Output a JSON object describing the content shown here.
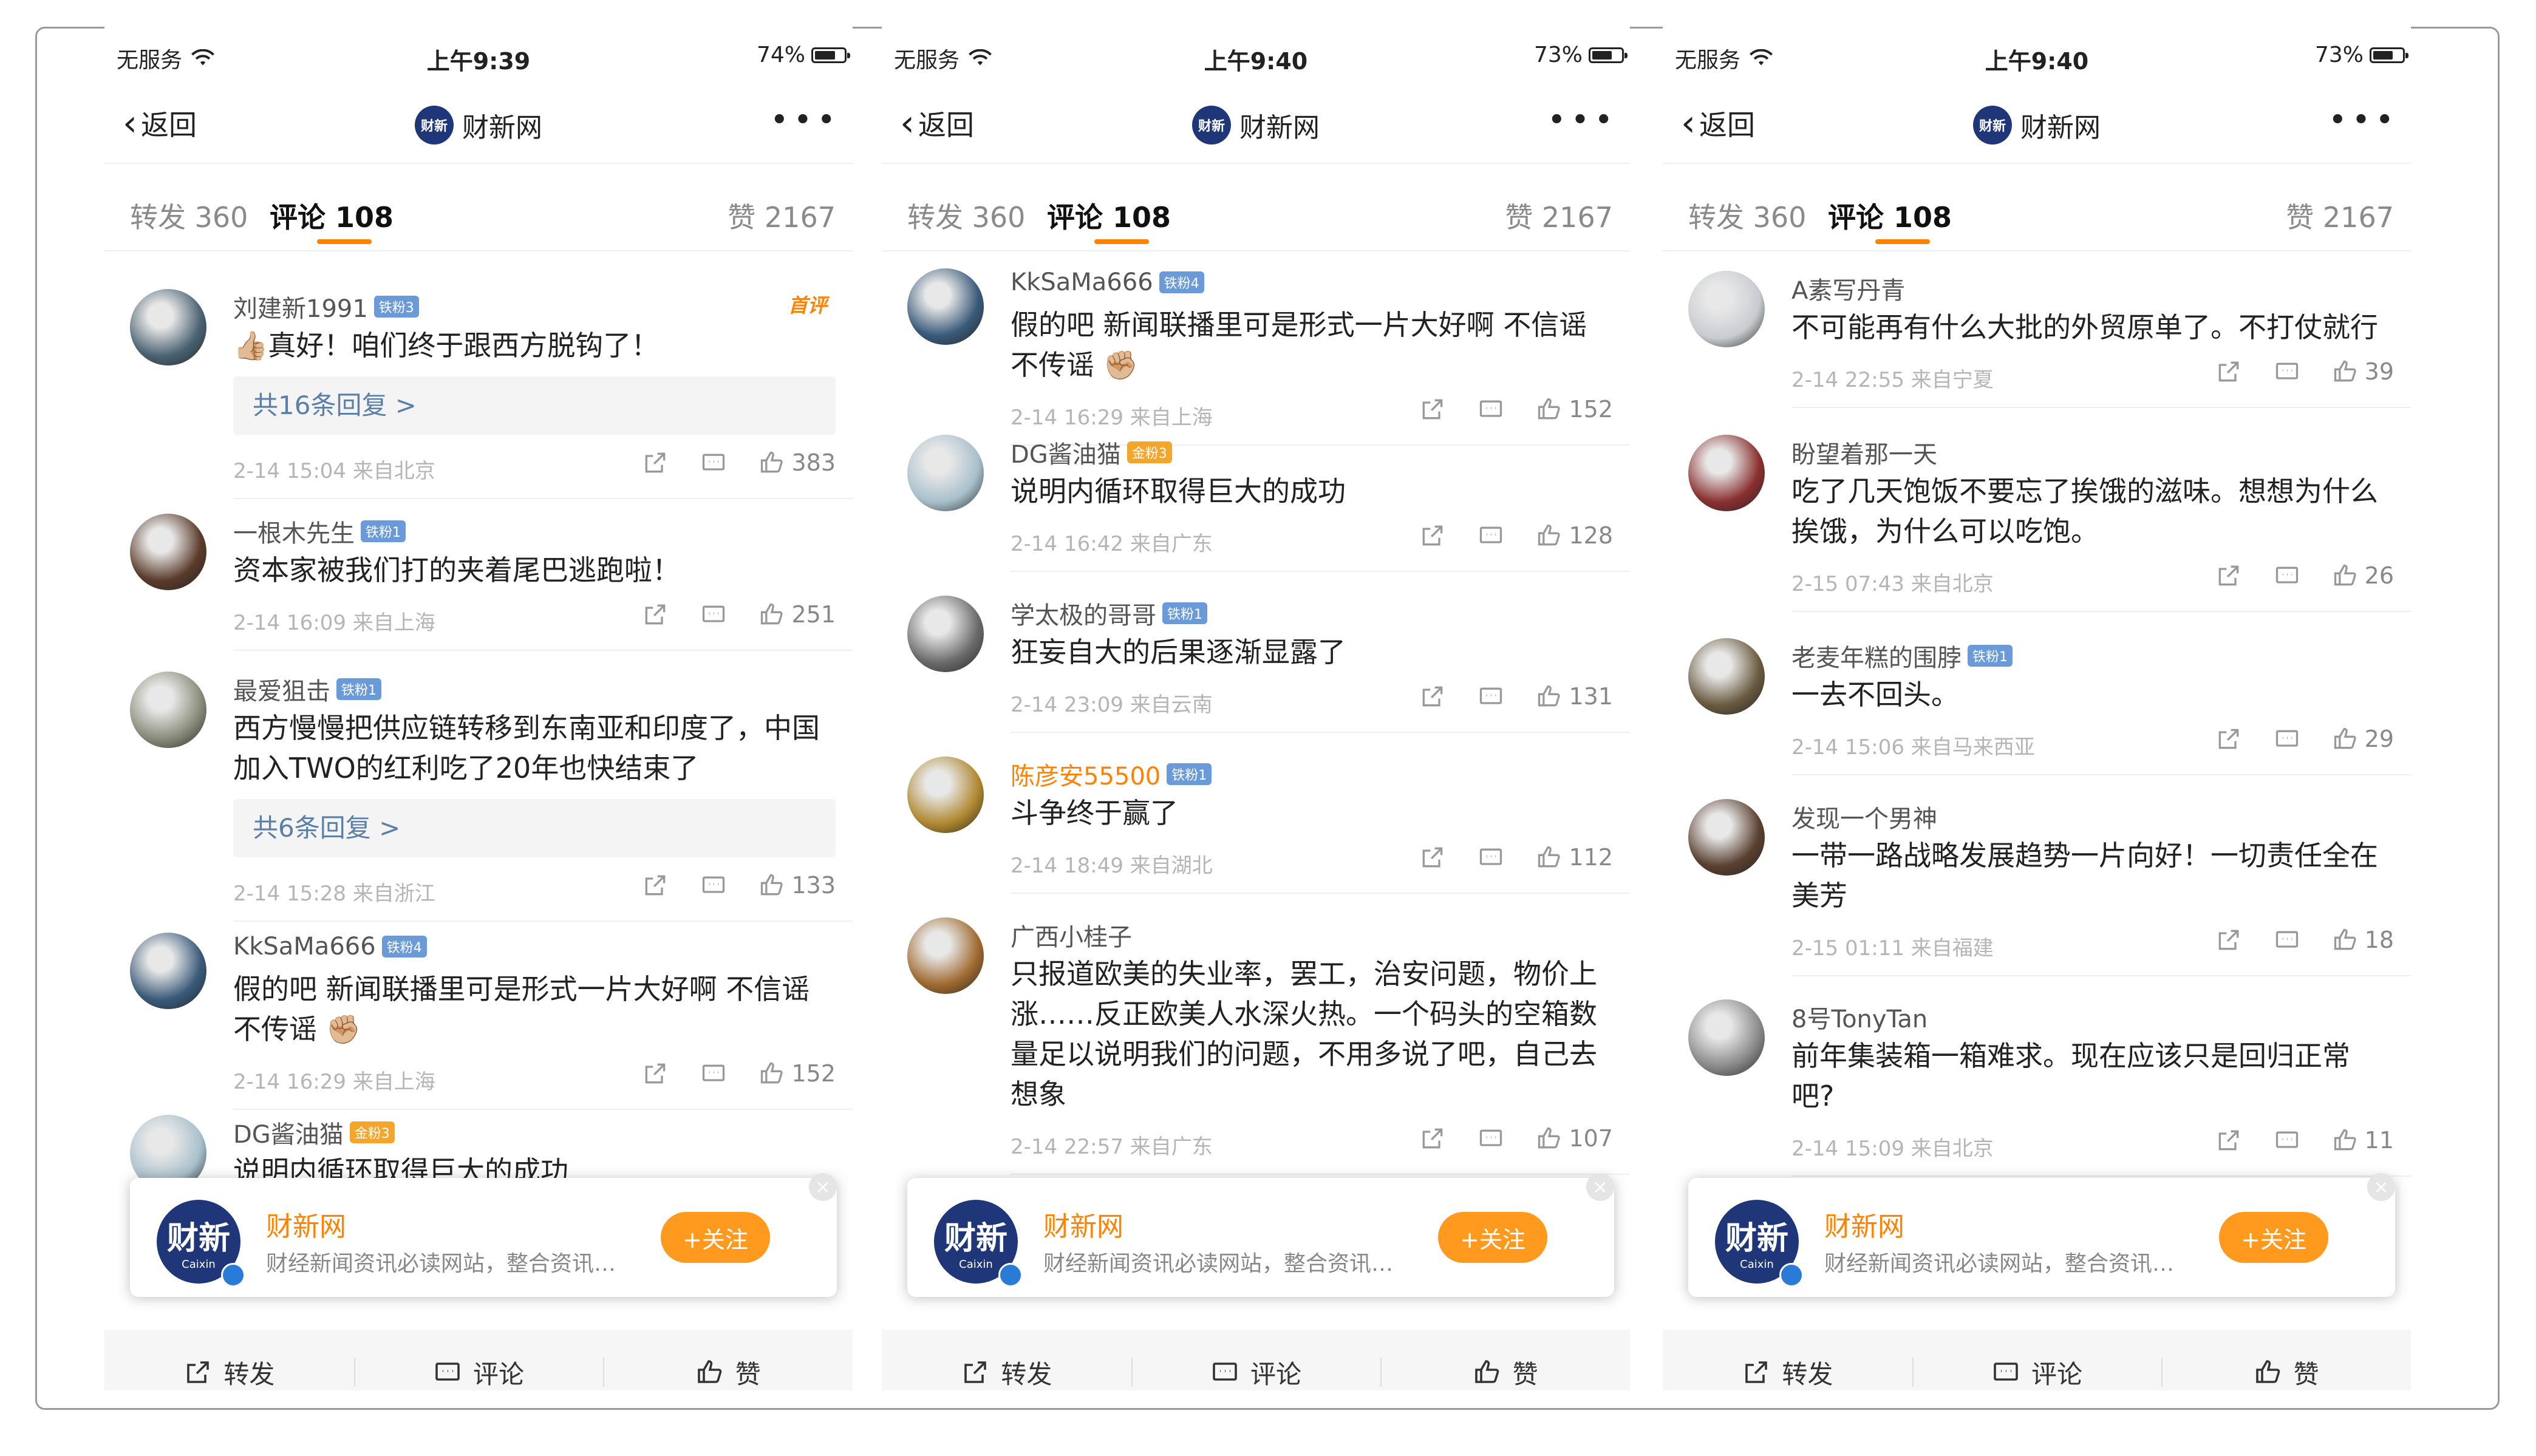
{
  "status_bars": [
    {
      "carrier": "无服务",
      "time": "上午9:39",
      "battery": "74%",
      "battery_level": 74
    },
    {
      "carrier": "无服务",
      "time": "上午9:40",
      "battery": "73%",
      "battery_level": 73
    },
    {
      "carrier": "无服务",
      "time": "上午9:40",
      "battery": "73%",
      "battery_level": 73
    }
  ],
  "nav": {
    "back": "返回",
    "title": "财新网",
    "logo_text": "财新"
  },
  "tabs": {
    "repost": "转发 360",
    "comments": "评论 108",
    "likes": "赞 2167"
  },
  "follow_card": {
    "logo": "财新",
    "logo_sub": "Caixin",
    "name": "财新网",
    "desc": "财经新闻资讯必读网站，整合资讯…",
    "button": "+关注",
    "close": "×"
  },
  "toolbar": {
    "repost": "转发",
    "comment": "评论",
    "like": "赞"
  },
  "phones": [
    {
      "comments": [
        {
          "name": "刘建新1991",
          "badge": "铁粉3",
          "label": "首评",
          "text": "👍🏼真好！咱们终于跟西方脱钩了！",
          "reply": "共16条回复 >",
          "meta": "2-14 15:04  来自北京",
          "likes": "383",
          "av": "#4a6272"
        },
        {
          "name": "一根木先生",
          "badge": "铁粉1",
          "text": "资本家被我们打的夹着尾巴逃跑啦！",
          "meta": "2-14 16:09  来自上海",
          "likes": "251",
          "av": "#5a3a2a"
        },
        {
          "name": "最爱狙击",
          "badge": "铁粉1",
          "text": "西方慢慢把供应链转移到东南亚和印度了，中国加入TWO的红利吃了20年也快结束了",
          "reply": "共6条回复 >",
          "meta": "2-14 15:28  来自浙江",
          "likes": "133",
          "av": "#8a8c7a"
        },
        {
          "name": "KkSaMa666",
          "badge": "铁粉4",
          "text": "假的吧 新闻联播里可是形式一片大好啊 不信谣不传谣 ✊🏼",
          "meta": "2-14 16:29  来自上海",
          "likes": "152",
          "av": "#3a5a7a"
        },
        {
          "name": "DG酱油猫",
          "badge": "金粉3",
          "gold": true,
          "text": "说明内循环取得巨大的成功",
          "meta": "",
          "likes": "",
          "av": "#a8c0cc"
        }
      ]
    },
    {
      "comments": [
        {
          "name": "KkSaMa666",
          "badge": "铁粉4",
          "text": "假的吧 新闻联播里可是形式一片大好啊 不信谣不传谣 ✊🏼",
          "meta": "2-14 16:29  来自上海",
          "likes": "152",
          "av": "#3a5a7a"
        },
        {
          "name": "DG酱油猫",
          "badge": "金粉3",
          "gold": true,
          "text": "说明内循环取得巨大的成功",
          "meta": "2-14 16:42  来自广东",
          "likes": "128",
          "av": "#a8c0cc"
        },
        {
          "name": "学太极的哥哥",
          "badge": "铁粉1",
          "text": "狂妄自大的后果逐渐显露了",
          "meta": "2-14 23:09  来自云南",
          "likes": "131",
          "av": "#6a6a6a"
        },
        {
          "name": "陈彦安55500",
          "badge": "铁粉1",
          "vip": true,
          "text": "斗争终于赢了",
          "meta": "2-14 18:49  来自湖北",
          "likes": "112",
          "av": "#b08830"
        },
        {
          "name": "广西小桂子",
          "badge": "",
          "text": "只报道欧美的失业率，罢工，治安问题，物价上涨……反正欧美人水深火热。一个码头的空箱数量足以说明我们的问题，不用多说了吧，自己去想象",
          "meta": "2-14 22:57  来自广东",
          "likes": "107",
          "av": "#a06a30"
        }
      ]
    },
    {
      "comments": [
        {
          "name": "A素写丹青",
          "badge": "",
          "text": "不可能再有什么大批的外贸原单了。不打仗就行",
          "meta": "2-14 22:55  来自宁夏",
          "likes": "39",
          "av": "#c8ccd0"
        },
        {
          "name": "盼望着那一天",
          "badge": "",
          "text": "吃了几天饱饭不要忘了挨饿的滋味。想想为什么挨饿，为什么可以吃饱。",
          "meta": "2-15 07:43  来自北京",
          "likes": "26",
          "av": "#8a3030"
        },
        {
          "name": "老麦年糕的围脖",
          "badge": "铁粉1",
          "text": "一去不回头。",
          "meta": "2-14 15:06  来自马来西亚",
          "likes": "29",
          "av": "#6a5a40"
        },
        {
          "name": "发现一个男神",
          "badge": "",
          "text": "一带一路战略发展趋势一片向好！一切责任全在美芳",
          "meta": "2-15 01:11  来自福建",
          "likes": "18",
          "av": "#5a4030"
        },
        {
          "name": "8号TonyTan",
          "badge": "",
          "text": "前年集装箱一箱难求。现在应该只是回归正常吧?",
          "meta": "2-14 15:09  来自北京",
          "likes": "11",
          "av": "#8a8a8a"
        }
      ]
    }
  ]
}
